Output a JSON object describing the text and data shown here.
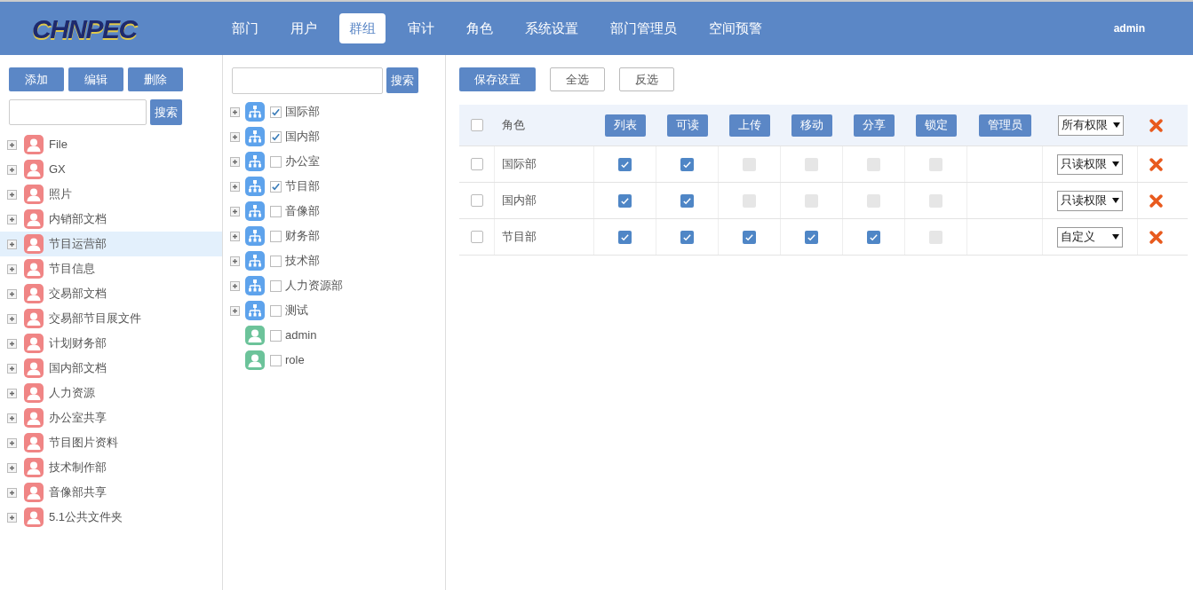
{
  "header": {
    "logo": "CHNPEC",
    "nav": [
      {
        "label": "部门",
        "selected": false
      },
      {
        "label": "用户",
        "selected": false
      },
      {
        "label": "群组",
        "selected": true
      },
      {
        "label": "审计",
        "selected": false
      },
      {
        "label": "角色",
        "selected": false
      },
      {
        "label": "系统设置",
        "selected": false
      },
      {
        "label": "部门管理员",
        "selected": false
      },
      {
        "label": "空间预警",
        "selected": false
      }
    ],
    "user": "admin"
  },
  "left_panel": {
    "buttons": [
      "添加",
      "编辑",
      "删除"
    ],
    "search_button": "搜索",
    "items": [
      {
        "label": "File",
        "selected": false
      },
      {
        "label": "GX",
        "selected": false
      },
      {
        "label": "照片",
        "selected": false
      },
      {
        "label": "内销部文档",
        "selected": false
      },
      {
        "label": "节目运营部",
        "selected": true
      },
      {
        "label": "节目信息",
        "selected": false
      },
      {
        "label": "交易部文档",
        "selected": false
      },
      {
        "label": "交易部节目展文件",
        "selected": false
      },
      {
        "label": "计划财务部",
        "selected": false
      },
      {
        "label": "国内部文档",
        "selected": false
      },
      {
        "label": "人力资源",
        "selected": false
      },
      {
        "label": "办公室共享",
        "selected": false
      },
      {
        "label": "节目图片资料",
        "selected": false
      },
      {
        "label": "技术制作部",
        "selected": false
      },
      {
        "label": "音像部共享",
        "selected": false
      },
      {
        "label": "5.1公共文件夹",
        "selected": false
      }
    ]
  },
  "middle_panel": {
    "search_button": "搜索",
    "items": [
      {
        "kind": "group",
        "label": "国际部",
        "checked": true
      },
      {
        "kind": "group",
        "label": "国内部",
        "checked": true
      },
      {
        "kind": "group",
        "label": "办公室",
        "checked": false
      },
      {
        "kind": "group",
        "label": "节目部",
        "checked": true
      },
      {
        "kind": "group",
        "label": "音像部",
        "checked": false
      },
      {
        "kind": "group",
        "label": "财务部",
        "checked": false
      },
      {
        "kind": "group",
        "label": "技术部",
        "checked": false
      },
      {
        "kind": "group",
        "label": "人力资源部",
        "checked": false
      },
      {
        "kind": "group",
        "label": "测试",
        "checked": false
      },
      {
        "kind": "user",
        "label": "admin",
        "checked": false
      },
      {
        "kind": "user",
        "label": "role",
        "checked": false
      }
    ]
  },
  "right_panel": {
    "buttons": [
      {
        "label": "保存设置",
        "kind": "primary"
      },
      {
        "label": "全选",
        "kind": "outline"
      },
      {
        "label": "反选",
        "kind": "outline"
      }
    ],
    "table": {
      "header_checked": false,
      "role_column": "角色",
      "permission_columns": [
        "列表",
        "可读",
        "上传",
        "移动",
        "分享",
        "锁定",
        "管理员"
      ],
      "header_select": "所有权限",
      "rows": [
        {
          "checked": false,
          "role": "国际部",
          "perms": [
            true,
            true,
            false,
            false,
            false,
            false
          ],
          "select": "只读权限"
        },
        {
          "checked": false,
          "role": "国内部",
          "perms": [
            true,
            true,
            false,
            false,
            false,
            false
          ],
          "select": "只读权限"
        },
        {
          "checked": false,
          "role": "节目部",
          "perms": [
            true,
            true,
            true,
            true,
            true,
            false
          ],
          "select": "自定义"
        }
      ]
    }
  }
}
